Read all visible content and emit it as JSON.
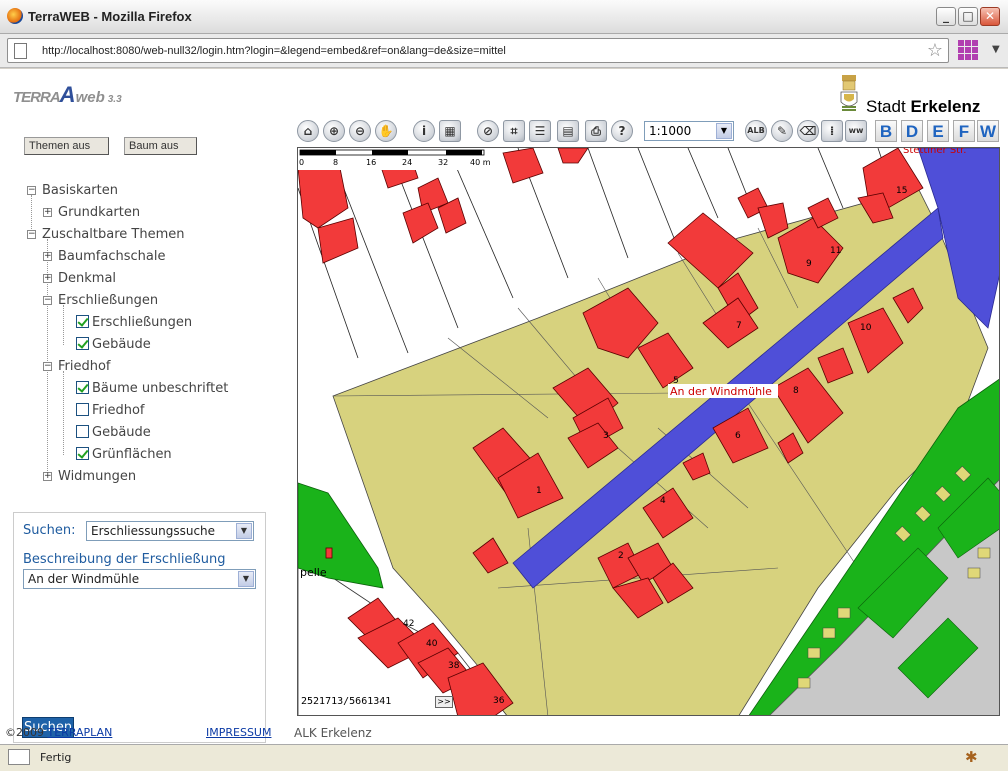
{
  "window": {
    "title": "TerraWEB - Mozilla Firefox",
    "minimize": "_",
    "maximize": "□",
    "close": "✕"
  },
  "navbar": {
    "url": "http://localhost:8080/web-null32/login.htm?login=&legend=embed&ref=on&lang=de&size=mittel"
  },
  "header": {
    "logo_terra": "TERRA",
    "logo_a": "A",
    "logo_web": "web",
    "logo_version": "3.3",
    "city_prefix": "Stadt",
    "city_name": "Erkelenz"
  },
  "sidebar": {
    "themes_off_button": "Themen aus",
    "tree_off_button": "Baum aus",
    "tree": [
      {
        "label": "Basiskarten",
        "level": 0,
        "expander": "-"
      },
      {
        "label": "Grundkarten",
        "level": 1,
        "expander": "+"
      },
      {
        "label": "Zuschaltbare Themen",
        "level": 0,
        "expander": "-"
      },
      {
        "label": "Baumfachschale",
        "level": 1,
        "expander": "+"
      },
      {
        "label": "Denkmal",
        "level": 1,
        "expander": "+"
      },
      {
        "label": "Erschließungen",
        "level": 1,
        "expander": "-"
      },
      {
        "label": "Erschließungen",
        "level": 2,
        "checked": true
      },
      {
        "label": "Gebäude",
        "level": 2,
        "checked": true
      },
      {
        "label": "Friedhof",
        "level": 1,
        "expander": "-"
      },
      {
        "label": "Bäume unbeschriftet",
        "level": 2,
        "checked": true
      },
      {
        "label": "Friedhof",
        "level": 2,
        "checked": false
      },
      {
        "label": "Gebäude",
        "level": 2,
        "checked": false
      },
      {
        "label": "Grünflächen",
        "level": 2,
        "checked": true
      },
      {
        "label": "Widmungen",
        "level": 1,
        "expander": "+"
      }
    ]
  },
  "search": {
    "label": "Suchen:",
    "type_value": "Erschliessungssuche",
    "desc_label": "Beschreibung der Erschließung",
    "desc_value": "An der Windmühle",
    "button": "Suchen"
  },
  "toolbar": {
    "scale_value": "1:1000",
    "alb_label": "ALB",
    "info_label": "i",
    "help_label": "?",
    "lang_buttons": [
      "B",
      "D",
      "E",
      "F",
      "W"
    ]
  },
  "map": {
    "street_label": "An der Windmühle",
    "top_street_label": "Stettiner Str.",
    "partial_label": "pelle",
    "coords": "2521713/5661341",
    "expand_button": ">>",
    "house_numbers": [
      "1",
      "2",
      "3",
      "4",
      "5",
      "6",
      "7",
      "8",
      "9",
      "10",
      "11",
      "15",
      "36",
      "38",
      "40",
      "42"
    ],
    "scale_ticks": [
      "0",
      "8",
      "16",
      "24",
      "32",
      "40 m"
    ]
  },
  "footer": {
    "copyright": "©2009",
    "terraplan": "TERRAPLAN",
    "impressum": "IMPRESSUM",
    "alk": "ALK Erkelenz"
  },
  "status": {
    "text": "Fertig"
  },
  "colors": {
    "parcel_yellow": "#d7d27e",
    "building_red": "#f23a3a",
    "street_blue": "#4f4fd8",
    "green": "#1ab31a",
    "accent_blue": "#1e62a8"
  }
}
